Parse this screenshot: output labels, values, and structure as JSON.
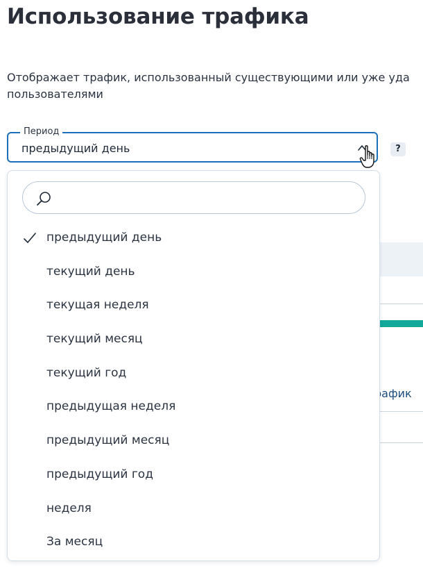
{
  "page": {
    "title": "Использование трафика",
    "description_line1": "Отображает трафик, использованный существующими или уже уда",
    "description_line2": "пользователями"
  },
  "period_select": {
    "label": "Период",
    "value": "предыдущий день",
    "help": "?"
  },
  "dropdown": {
    "search_placeholder": "",
    "options": [
      {
        "label": "предыдущий день",
        "selected": true
      },
      {
        "label": "текущий день",
        "selected": false
      },
      {
        "label": "текущая неделя",
        "selected": false
      },
      {
        "label": "текущий месяц",
        "selected": false
      },
      {
        "label": "текущий год",
        "selected": false
      },
      {
        "label": "предыдущая неделя",
        "selected": false
      },
      {
        "label": "предыдущий месяц",
        "selected": false
      },
      {
        "label": "предыдущий год",
        "selected": false
      },
      {
        "label": "неделя",
        "selected": false
      },
      {
        "label": "За месяц",
        "selected": false
      }
    ]
  },
  "background": {
    "traffic_label": "рафик"
  },
  "icons": {
    "chevron": "chevron-up-icon",
    "search": "search-icon",
    "check": "check-icon",
    "cursor": "hand-pointer-icon"
  },
  "colors": {
    "accent": "#1c6fb8",
    "teal": "#12a89a",
    "border": "#d5dee8"
  }
}
